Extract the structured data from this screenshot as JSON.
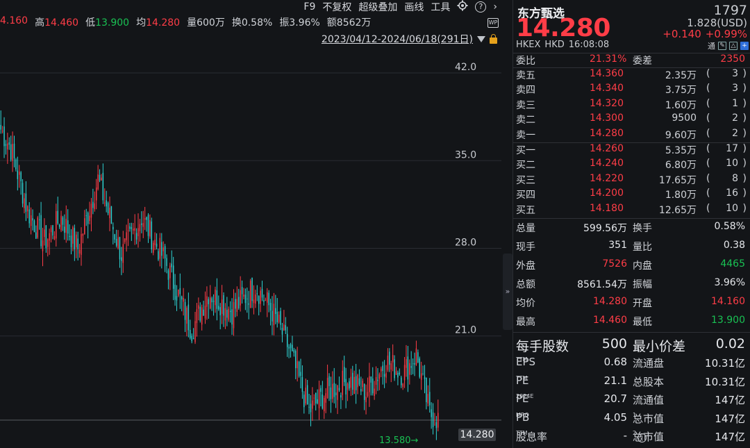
{
  "toolbar": {
    "items": [
      "F9",
      "不复权",
      "超级叠加",
      "画线",
      "工具"
    ],
    "settings_icon": "gear-icon",
    "help_icon": "question-icon",
    "more_icon": "chevron-right-icon"
  },
  "stats": {
    "open": "4.160",
    "high_label": "高",
    "high": "14.460",
    "low_label": "低",
    "low": "13.900",
    "avg_label": "均",
    "avg": "14.280",
    "volume": "量600万",
    "turnover_rate": "换0.58%",
    "amplitude": "振3.96%",
    "amount": "额8562万"
  },
  "range": {
    "text": "2023/04/12-2024/06/18(291日)"
  },
  "chart_data": {
    "type": "candlestick",
    "y_ticks": [
      "42.0",
      "35.0",
      "28.0",
      "21.0"
    ],
    "ylim": [
      13.0,
      42.5
    ],
    "current_price_tag": "14.280",
    "low_marker": "13.580",
    "hidden_tick": "14.0",
    "colors": {
      "up": "#ff3d47",
      "down": "#2ed3d3",
      "grid": "#2a2d32"
    },
    "segments": [
      {
        "from": 37.5,
        "to": 36.0,
        "n": 6
      },
      {
        "from": 36.0,
        "to": 31.0,
        "n": 10
      },
      {
        "from": 31.0,
        "to": 28.5,
        "n": 10
      },
      {
        "from": 28.5,
        "to": 30.5,
        "n": 10
      },
      {
        "from": 30.5,
        "to": 28.0,
        "n": 10
      },
      {
        "from": 28.0,
        "to": 33.5,
        "n": 12
      },
      {
        "from": 33.5,
        "to": 27.5,
        "n": 14
      },
      {
        "from": 27.5,
        "to": 30.5,
        "n": 12
      },
      {
        "from": 30.5,
        "to": 27.0,
        "n": 14
      },
      {
        "from": 27.0,
        "to": 21.5,
        "n": 16
      },
      {
        "from": 21.5,
        "to": 24.5,
        "n": 10
      },
      {
        "from": 24.5,
        "to": 23.0,
        "n": 14
      },
      {
        "from": 23.0,
        "to": 25.0,
        "n": 14
      },
      {
        "from": 25.0,
        "to": 23.0,
        "n": 10
      },
      {
        "from": 23.0,
        "to": 20.0,
        "n": 10
      },
      {
        "from": 20.0,
        "to": 15.0,
        "n": 12
      },
      {
        "from": 15.0,
        "to": 16.5,
        "n": 10
      },
      {
        "from": 16.5,
        "to": 17.5,
        "n": 14
      },
      {
        "from": 17.5,
        "to": 16.5,
        "n": 10
      },
      {
        "from": 16.5,
        "to": 19.0,
        "n": 12
      },
      {
        "from": 19.0,
        "to": 18.0,
        "n": 10
      },
      {
        "from": 18.0,
        "to": 19.5,
        "n": 8
      },
      {
        "from": 19.5,
        "to": 14.8,
        "n": 8
      },
      {
        "from": 14.8,
        "to": 14.28,
        "n": 6
      }
    ]
  },
  "quote": {
    "name": "东方甄选",
    "code": "1797",
    "price": "14.280",
    "usd_price": "1.828(USD)",
    "change": "+0.140",
    "change_pct": "+0.99%",
    "exchange": "HKEX",
    "currency": "HKD",
    "time": "16:08:08",
    "tong_label": "通"
  },
  "committee": {
    "ratio_label": "委比",
    "ratio": "21.31%",
    "diff_label": "委差",
    "diff": "2350"
  },
  "asks": [
    {
      "label": "卖五",
      "price": "14.360",
      "vol": "2.35万",
      "count": "3"
    },
    {
      "label": "卖四",
      "price": "14.340",
      "vol": "3.75万",
      "count": "3"
    },
    {
      "label": "卖三",
      "price": "14.320",
      "vol": "1.60万",
      "count": "1"
    },
    {
      "label": "卖二",
      "price": "14.300",
      "vol": "9500",
      "count": "2"
    },
    {
      "label": "卖一",
      "price": "14.280",
      "vol": "9.60万",
      "count": "2"
    }
  ],
  "bids": [
    {
      "label": "买一",
      "price": "14.260",
      "vol": "5.35万",
      "count": "17"
    },
    {
      "label": "买二",
      "price": "14.240",
      "vol": "6.80万",
      "count": "10"
    },
    {
      "label": "买三",
      "price": "14.220",
      "vol": "17.65万",
      "count": "8"
    },
    {
      "label": "买四",
      "price": "14.200",
      "vol": "1.80万",
      "count": "16"
    },
    {
      "label": "买五",
      "price": "14.180",
      "vol": "12.65万",
      "count": "10"
    }
  ],
  "statistics": [
    {
      "l1": "总量",
      "v1": "599.56万",
      "c1": "white",
      "l2": "换手",
      "v2": "0.58%",
      "c2": "white"
    },
    {
      "l1": "现手",
      "v1": "351",
      "c1": "white",
      "l2": "量比",
      "v2": "0.38",
      "c2": "white"
    },
    {
      "l1": "外盘",
      "v1": "7526",
      "c1": "red",
      "l2": "内盘",
      "v2": "4465",
      "c2": "green"
    },
    {
      "l1": "总额",
      "v1": "8561.54万",
      "c1": "white",
      "l2": "振幅",
      "v2": "3.96%",
      "c2": "white"
    },
    {
      "l1": "均价",
      "v1": "14.280",
      "c1": "red",
      "l2": "开盘",
      "v2": "14.160",
      "c2": "red"
    },
    {
      "l1": "最高",
      "v1": "14.460",
      "c1": "red",
      "l2": "最低",
      "v2": "13.900",
      "c2": "green"
    }
  ],
  "lot": {
    "lot_label": "每手股数",
    "lot_value": "500",
    "tick_label": "最小价差",
    "tick_value": "0.02"
  },
  "fundamentals": [
    {
      "l1": "EPS",
      "sup1": "TTM",
      "v1": "0.68",
      "l2": "流通盘",
      "sup2": "",
      "v2": "10.31亿"
    },
    {
      "l1": "PE",
      "sup1": "TTM",
      "v1": "21.1",
      "l2": "总股本",
      "sup2": "",
      "v2": "10.31亿"
    },
    {
      "l1": "PE",
      "sup1": "2024E",
      "v1": "20.7",
      "l2": "流通值",
      "sup2": "",
      "v2": "147亿"
    },
    {
      "l1": "PB",
      "sup1": "MRQ",
      "v1": "4.05",
      "l2": "总市值",
      "sup2": "1",
      "v2": "147亿"
    },
    {
      "l1": "股息率",
      "sup1": "TTM",
      "v1": "-",
      "l2": "总市值",
      "sup2": "2",
      "v2": "147亿"
    }
  ]
}
